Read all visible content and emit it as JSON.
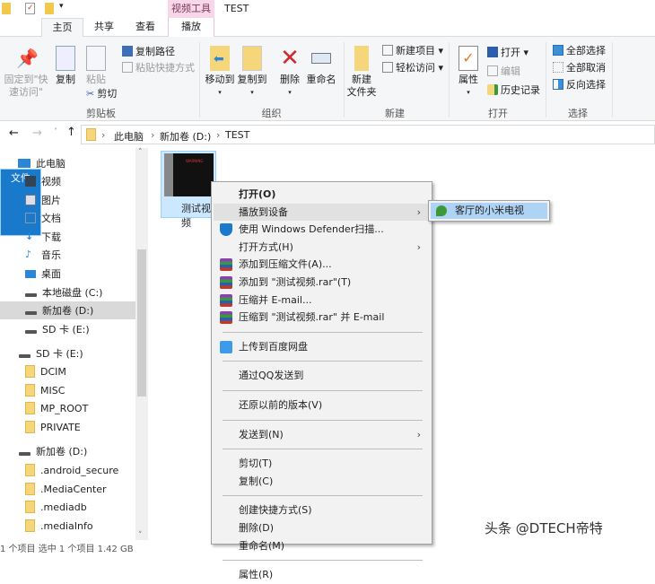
{
  "window": {
    "title": "TEST",
    "contextual_tab_group": "视频工具"
  },
  "tabs": [
    {
      "label": "文件"
    },
    {
      "label": "主页"
    },
    {
      "label": "共享"
    },
    {
      "label": "查看"
    },
    {
      "label": "播放"
    }
  ],
  "ribbon": {
    "clipboard": {
      "label": "剪贴板",
      "pin": "固定到\"快速访问\"",
      "copy": "复制",
      "paste": "粘贴",
      "copy_path": "复制路径",
      "paste_shortcut": "粘贴快捷方式",
      "cut": "剪切"
    },
    "organize": {
      "label": "组织",
      "move_to": "移动到",
      "copy_to": "复制到",
      "delete": "删除",
      "rename": "重命名"
    },
    "new": {
      "label": "新建",
      "new_folder": "新建\n文件夹",
      "new_item": "新建项目 ▾",
      "easy_access": "轻松访问 ▾"
    },
    "open": {
      "label": "打开",
      "properties": "属性",
      "open": "打开 ▾",
      "edit": "编辑",
      "history": "历史记录"
    },
    "select": {
      "label": "选择",
      "select_all": "全部选择",
      "select_none": "全部取消",
      "invert": "反向选择"
    }
  },
  "address": {
    "crumbs": [
      "此电脑",
      "新加卷 (D:)",
      "TEST"
    ]
  },
  "nav": {
    "items": [
      "此电脑",
      "视频",
      "图片",
      "文档",
      "下载",
      "音乐",
      "桌面",
      "本地磁盘 (C:)",
      "新加卷 (D:)",
      "SD 卡 (E:)"
    ],
    "sd": {
      "label": "SD 卡 (E:)",
      "folders": [
        "DCIM",
        "MISC",
        "MP_ROOT",
        "PRIVATE"
      ]
    },
    "d": {
      "label": "新加卷 (D:)",
      "folders": [
        ".android_secure",
        ".MediaCenter",
        ".mediadb",
        ".mediaInfo"
      ]
    }
  },
  "file": {
    "name": "测试视频",
    "thumb_text": "WARNING"
  },
  "context_menu": {
    "items": [
      "打开(O)",
      "播放到设备",
      "使用 Windows Defender扫描...",
      "打开方式(H)",
      "添加到压缩文件(A)...",
      "添加到 \"测试视频.rar\"(T)",
      "压缩并 E-mail...",
      "压缩到 \"测试视频.rar\" 并 E-mail",
      "上传到百度网盘",
      "通过QQ发送到",
      "还原以前的版本(V)",
      "发送到(N)",
      "剪切(T)",
      "复制(C)",
      "创建快捷方式(S)",
      "删除(D)",
      "重命名(M)",
      "属性(R)"
    ],
    "submenu": {
      "device": "客厅的小米电视"
    }
  },
  "status": {
    "text": "1 个项目    选中 1 个项目  1.42 GB"
  },
  "watermark": "头条 @DTECH帝特",
  "colors": {
    "file_tab": "#1979ca",
    "selection": "#cce8ff",
    "submenu_highlight": "#aed3f5",
    "delete_red": "#d0282e"
  }
}
